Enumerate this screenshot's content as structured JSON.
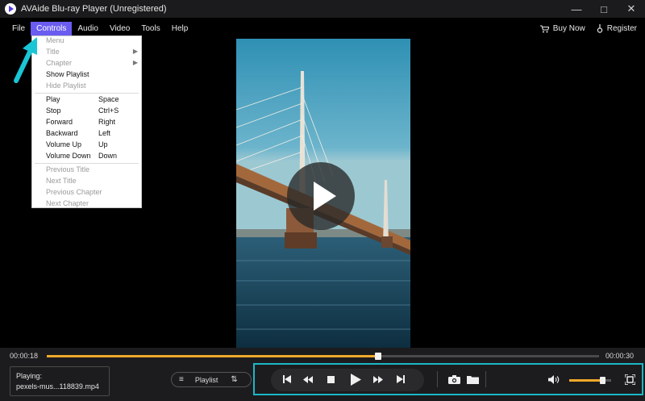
{
  "window": {
    "title": "AVAide Blu-ray Player (Unregistered)"
  },
  "menubar": {
    "items": [
      "File",
      "Controls",
      "Audio",
      "Video",
      "Tools",
      "Help"
    ],
    "active": "Controls",
    "buy_now": "Buy Now",
    "register": "Register"
  },
  "controls_menu": {
    "menu": "Menu",
    "title": "Title",
    "chapter": "Chapter",
    "show_playlist": "Show Playlist",
    "hide_playlist": "Hide Playlist",
    "play": "Play",
    "play_sc": "Space",
    "stop": "Stop",
    "stop_sc": "Ctrl+S",
    "forward": "Forward",
    "forward_sc": "Right",
    "backward": "Backward",
    "backward_sc": "Left",
    "volume_up": "Volume Up",
    "volume_up_sc": "Up",
    "volume_down": "Volume Down",
    "volume_down_sc": "Down",
    "previous_title": "Previous Title",
    "next_title": "Next Title",
    "previous_chapter": "Previous Chapter",
    "next_chapter": "Next Chapter"
  },
  "player": {
    "current_time": "00:00:18",
    "total_time": "00:00:30",
    "progress": 0.6,
    "playing_label": "Playing:",
    "filename": "pexels-mus...118839.mp4",
    "playlist_label": "Playlist",
    "volume": 0.78
  },
  "colors": {
    "accent": "#f0a92a",
    "menu_active": "#6a5cf0",
    "highlight": "#1cb7c6"
  }
}
